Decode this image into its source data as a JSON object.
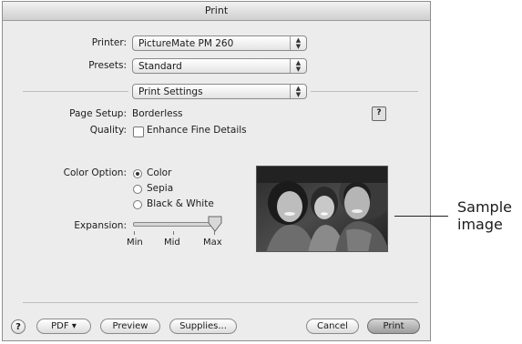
{
  "dialog": {
    "title": "Print",
    "printer": {
      "label": "Printer:",
      "value": "PictureMate PM 260"
    },
    "presets": {
      "label": "Presets:",
      "value": "Standard"
    },
    "panel_select": {
      "value": "Print Settings"
    },
    "page_setup": {
      "label": "Page Setup:",
      "value": "Borderless"
    },
    "quality": {
      "label": "Quality:",
      "option": "Enhance Fine Details",
      "checked": false
    },
    "color_option": {
      "label": "Color Option:",
      "options": [
        "Color",
        "Sepia",
        "Black & White"
      ],
      "selected": "Color"
    },
    "expansion": {
      "label": "Expansion:",
      "ticks": [
        "Min",
        "Mid",
        "Max"
      ],
      "value": "Max"
    },
    "buttons": {
      "help": "?",
      "pdf": "PDF ▾",
      "preview": "Preview",
      "supplies": "Supplies...",
      "cancel": "Cancel",
      "print": "Print"
    }
  },
  "callout": {
    "line1": "Sample",
    "line2": "image"
  },
  "colors": {
    "dialog_bg": "#ececec",
    "default_button": "#a8a8a8"
  }
}
